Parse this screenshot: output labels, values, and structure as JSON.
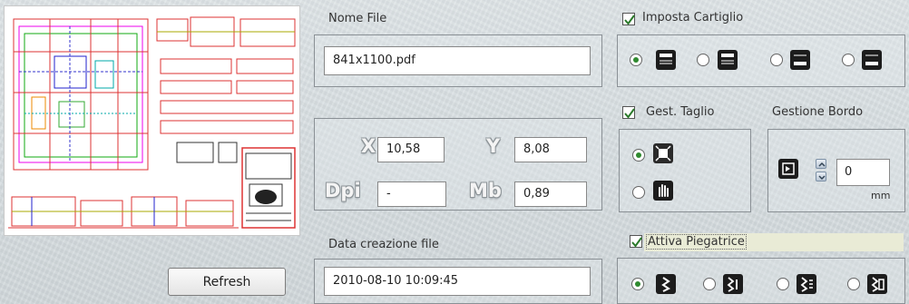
{
  "file": {
    "name_label": "Nome File",
    "name_value": "841x1100.pdf",
    "x_label": "X",
    "x_value": "10,58",
    "y_label": "Y",
    "y_value": "8,08",
    "dpi_label": "Dpi",
    "dpi_value": "-",
    "mb_label": "Mb",
    "mb_value": "0,89",
    "date_label": "Data creazione file",
    "date_value": "2010-08-10 10:09:45"
  },
  "preview": {
    "refresh_label": "Refresh"
  },
  "cartiglio": {
    "label": "Imposta Cartiglio",
    "checked": true,
    "options": [
      "cartiglio-top-left-icon",
      "cartiglio-top-right-icon",
      "cartiglio-bottom-left-icon",
      "cartiglio-bottom-right-icon"
    ],
    "selected_index": 0
  },
  "taglio": {
    "label": "Gest. Taglio",
    "checked": true,
    "options": [
      "auto-cut-icon",
      "manual-cut-icon"
    ],
    "selected_index": 0
  },
  "bordo": {
    "label": "Gestione Bordo",
    "value": "0",
    "unit": "mm"
  },
  "piegatrice": {
    "label": "Attiva Piegatrice",
    "checked": true,
    "options": [
      "fold-mode-1-icon",
      "fold-mode-2-icon",
      "fold-mode-3-icon",
      "fold-mode-4-icon"
    ],
    "selected_index": 0
  },
  "colors": {
    "radio_selected": "#2f8a2f",
    "checkbox_check": "#2a7a2a",
    "highlight_label_bg": "#e9ebd6"
  }
}
